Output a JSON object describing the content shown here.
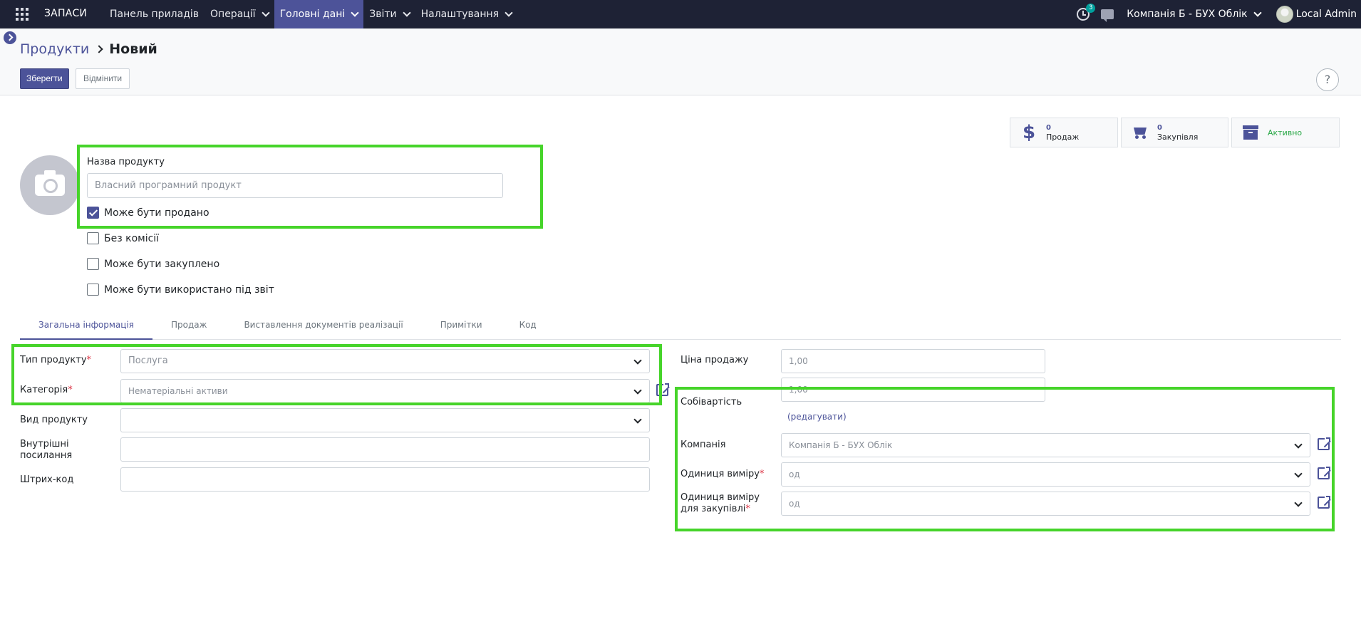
{
  "navbar": {
    "brand": "ЗАПАСИ",
    "menu": [
      {
        "label": "Панель приладів",
        "has_dropdown": false,
        "active": false
      },
      {
        "label": "Операції",
        "has_dropdown": true,
        "active": false
      },
      {
        "label": "Головні дані",
        "has_dropdown": true,
        "active": true
      },
      {
        "label": "Звіти",
        "has_dropdown": true,
        "active": false
      },
      {
        "label": "Налаштування",
        "has_dropdown": true,
        "active": false
      }
    ],
    "activity_badge": "3",
    "company": "Компанія Б - БУХ Облік",
    "user": "Local Admin"
  },
  "breadcrumb": {
    "parent": "Продукти",
    "current": "Новий"
  },
  "actions": {
    "save": "Зберегти",
    "discard": "Відмінити",
    "help": "?"
  },
  "smart_buttons": {
    "sales": {
      "value": "0",
      "label": "Продаж"
    },
    "purchase": {
      "value": "0",
      "label": "Закупівля"
    },
    "active": {
      "label": "Активно"
    }
  },
  "title": {
    "name_label": "Назва продукту",
    "name_placeholder": "Власний програмний продукт"
  },
  "options": [
    {
      "label": "Може бути продано",
      "checked": true
    },
    {
      "label": "Без комісії",
      "checked": false
    },
    {
      "label": "Може бути закуплено",
      "checked": false
    },
    {
      "label": "Може бути використано під звіт",
      "checked": false
    }
  ],
  "tabs": [
    {
      "label": "Загальна інформація",
      "active": true
    },
    {
      "label": "Продаж",
      "active": false
    },
    {
      "label": "Виставлення документів реалізації",
      "active": false
    },
    {
      "label": "Примітки",
      "active": false
    },
    {
      "label": "Код",
      "active": false
    }
  ],
  "left_fields": {
    "product_type": {
      "label": "Тип продукту",
      "value": "Послуга"
    },
    "category": {
      "label": "Категорія",
      "value": "Нематеріальні активи"
    },
    "product_kind": {
      "label": "Вид продукту",
      "value": ""
    },
    "internal_ref": {
      "label": "Внутрішні посилання",
      "value": ""
    },
    "barcode": {
      "label": "Штрих-код",
      "value": ""
    }
  },
  "right_fields": {
    "sale_price": {
      "label": "Ціна продажу",
      "value": "1,00"
    },
    "cost": {
      "label": "Собівартість",
      "value": "1,00",
      "edit_link": "(редагувати)"
    },
    "company": {
      "label": "Компанія",
      "value": "Компанія Б - БУХ Облік"
    },
    "uom": {
      "label": "Одиниця виміру",
      "value": "од"
    },
    "purchase_uom": {
      "label": "Одиниця виміру для закупівлі",
      "value": "од"
    }
  },
  "colors": {
    "navbar": "#1e2235",
    "primary": "#4c5399",
    "required": "#dc3545",
    "highlight": "#46d42a",
    "active_status": "#28a745"
  }
}
